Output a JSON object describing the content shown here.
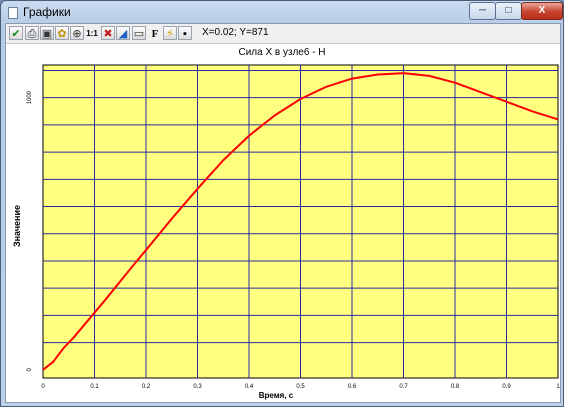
{
  "window": {
    "title": "Графики",
    "minimize_glyph": "─",
    "maximize_glyph": "□",
    "close_glyph": "X"
  },
  "toolbar": {
    "buttons": [
      {
        "icon": "checkmark-icon",
        "glyph": "✔",
        "color": "#1f8a1f"
      },
      {
        "icon": "print-icon",
        "glyph": "⎙",
        "color": "#333333"
      },
      {
        "icon": "copy-icon",
        "glyph": "▣",
        "color": "#333333"
      },
      {
        "icon": "palette-icon",
        "glyph": "✿",
        "color": "#c09000"
      },
      {
        "icon": "zoom-icon",
        "glyph": "⊕",
        "color": "#333333"
      },
      {
        "icon": "scale-1-1-icon",
        "glyph": "1:1",
        "color": "#000000"
      },
      {
        "icon": "marker-icon",
        "glyph": "✖",
        "color": "#c02020"
      },
      {
        "icon": "area-chart-icon",
        "glyph": "◢",
        "color": "#2060c0"
      },
      {
        "icon": "monitor-icon",
        "glyph": "▭",
        "color": "#333333"
      },
      {
        "icon": "font-icon",
        "glyph": "F",
        "color": "#000000"
      },
      {
        "icon": "lightning-icon",
        "glyph": "⚡",
        "color": "#e0a000"
      },
      {
        "icon": "save-icon",
        "glyph": "▪",
        "color": "#000000"
      }
    ],
    "coordinates": "X=0.02; Y=871"
  },
  "colors": {
    "plot_background": "#ffff80",
    "grid_line": "#2a2aa0",
    "curve": "#ff0000"
  },
  "chart_data": {
    "type": "line",
    "title": "Сила X в узле6 - Н",
    "xlabel": "Время, с",
    "ylabel": "Значение",
    "xlim": [
      0,
      1
    ],
    "ylim": [
      -30,
      1120
    ],
    "x_ticks": [
      "0",
      "0.1",
      "0.2",
      "0.3",
      "0.4",
      "0.5",
      "0.6",
      "0.7",
      "0.8",
      "0.9",
      "1"
    ],
    "y_ticks": [
      {
        "value": 0,
        "label": "0"
      },
      {
        "value": 1000,
        "label": "1000"
      }
    ],
    "grid": true,
    "series": [
      {
        "x": [
          0,
          0.02,
          0.04,
          0.06,
          0.08,
          0.1,
          0.12,
          0.15,
          0.18,
          0.2,
          0.25,
          0.3,
          0.35,
          0.4,
          0.45,
          0.5,
          0.55,
          0.6,
          0.65,
          0.7,
          0.75,
          0.8,
          0.85,
          0.9,
          0.95,
          1.0
        ],
        "y": [
          0,
          30,
          80,
          120,
          165,
          210,
          255,
          325,
          395,
          440,
          555,
          665,
          770,
          860,
          935,
          995,
          1040,
          1070,
          1085,
          1090,
          1080,
          1055,
          1020,
          985,
          950,
          920
        ]
      }
    ]
  }
}
